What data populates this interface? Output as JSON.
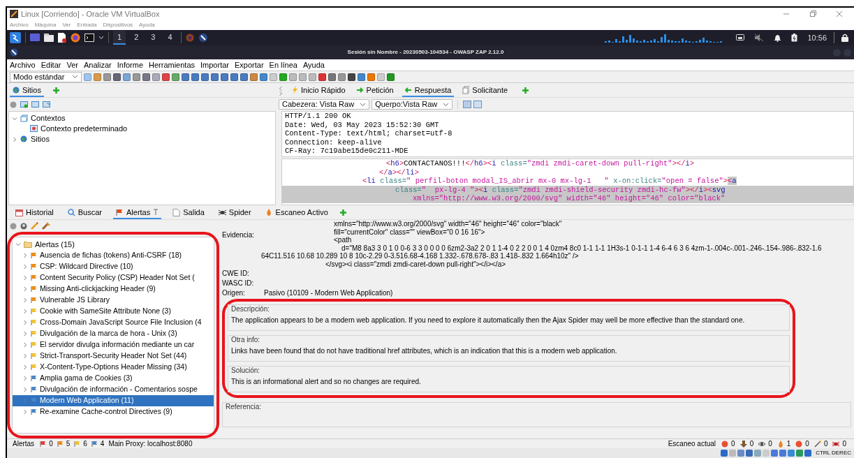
{
  "vbox_window": {
    "title": "Linux [Corriendo] - Oracle VM VirtualBox",
    "menu": [
      "Archivo",
      "Máquina",
      "Ver",
      "Entrada",
      "Dispositivos",
      "Ayuda"
    ]
  },
  "taskbar": {
    "workspaces": [
      {
        "label": "1",
        "selected": true
      },
      {
        "label": "2",
        "selected": false
      },
      {
        "label": "3",
        "selected": false
      },
      {
        "label": "4",
        "selected": false
      }
    ],
    "clock": "10:56"
  },
  "zap": {
    "title": "Sesión sin Nombre - 20230503-104534 - OWASP ZAP 2.12.0",
    "menu": [
      "Archivo",
      "Editar",
      "Ver",
      "Analizar",
      "Informe",
      "Herramientas",
      "Importar",
      "Exportar",
      "En línea",
      "Ayuda"
    ],
    "mode": "Modo estándar"
  },
  "left_tabs": [
    {
      "label": "Sitios",
      "selected": true
    }
  ],
  "right_tabs": [
    {
      "label": "Inicio Rápido",
      "selected": false
    },
    {
      "label": "Petición",
      "selected": false
    },
    {
      "label": "Respuesta",
      "selected": true
    },
    {
      "label": "Solicitante",
      "selected": false
    }
  ],
  "header_view": "Cabezera: Vista Raw",
  "body_view": "Querpo:Vista Raw",
  "sites_tree": [
    {
      "label": "Contextos",
      "expanded": true,
      "children": [
        {
          "label": "Contexto predeterminado"
        }
      ]
    },
    {
      "label": "Sitios",
      "expanded": false
    }
  ],
  "response_header": [
    "HTTP/1.1 200 OK",
    "Date: Wed, 03 May 2023 15:52:30 GMT",
    "Content-Type: text/html; charset=utf-8",
    "Connection: keep-alive",
    "CF-Ray: 7c19abe15de0c211-MDE"
  ],
  "response_body": [
    {
      "highlighted": false,
      "segments": [
        {
          "kind": "punct",
          "text": "<"
        },
        {
          "kind": "tag",
          "text": "h6"
        },
        {
          "kind": "punct",
          "text": ">"
        },
        {
          "kind": "text",
          "text": "CONTACTANOS!!!"
        },
        {
          "kind": "punct",
          "text": "</"
        },
        {
          "kind": "tag",
          "text": "h6"
        },
        {
          "kind": "punct",
          "text": "><"
        },
        {
          "kind": "tag",
          "text": "i"
        },
        {
          "kind": "attr",
          "text": " class="
        },
        {
          "kind": "value",
          "text": "\"zmdi zmdi-caret-down pull-right\""
        },
        {
          "kind": "punct",
          "text": "></"
        },
        {
          "kind": "tag",
          "text": "i"
        },
        {
          "kind": "punct",
          "text": ">"
        }
      ]
    },
    {
      "highlighted": false,
      "segments": [
        {
          "kind": "punct",
          "text": "</"
        },
        {
          "kind": "tag",
          "text": "a"
        },
        {
          "kind": "punct",
          "text": "></"
        },
        {
          "kind": "tag",
          "text": "li"
        },
        {
          "kind": "punct",
          "text": ">"
        }
      ]
    },
    {
      "highlighted": false,
      "segments": [
        {
          "kind": "punct",
          "text": "<"
        },
        {
          "kind": "tag",
          "text": "li"
        },
        {
          "kind": "attr",
          "text": " class="
        },
        {
          "kind": "value",
          "text": "\" perfil-boton modal_IS_abrir mx-0 mx-lg-1   \""
        },
        {
          "kind": "attr",
          "text": " x-on:click="
        },
        {
          "kind": "value",
          "text": "\"open = false\""
        },
        {
          "kind": "punct",
          "text": ">"
        },
        {
          "kind": "punct",
          "text": "<",
          "highlighted": true
        },
        {
          "kind": "tag",
          "text": "a",
          "highlighted": true
        }
      ]
    },
    {
      "highlighted": true,
      "segments": [
        {
          "kind": "attr",
          "text": "class="
        },
        {
          "kind": "value",
          "text": "\"  px-lg-4 \""
        },
        {
          "kind": "punct",
          "text": "><"
        },
        {
          "kind": "tag",
          "text": "i"
        },
        {
          "kind": "attr",
          "text": " class="
        },
        {
          "kind": "value",
          "text": "\"zmdi zmdi-shield-security zmdi-hc-fw\""
        },
        {
          "kind": "punct",
          "text": "></"
        },
        {
          "kind": "tag",
          "text": "i"
        },
        {
          "kind": "punct",
          "text": "><"
        },
        {
          "kind": "tag",
          "text": "svg"
        }
      ]
    },
    {
      "highlighted": true,
      "segments": [
        {
          "kind": "value",
          "text": "xmlns=\"http://www.w3.org/2000/svg\" width=\"46\" height=\"46\" color=\"black\""
        }
      ]
    }
  ],
  "bottom_tabs": [
    {
      "label": "Historial",
      "selected": false
    },
    {
      "label": "Buscar",
      "selected": false
    },
    {
      "label": "Alertas",
      "selected": true
    },
    {
      "label": "Salida",
      "selected": false
    },
    {
      "label": "Spider",
      "selected": false
    },
    {
      "label": "Escaneo Activo",
      "selected": false
    }
  ],
  "alerts": {
    "label": "Alertas (15)",
    "expanded": true,
    "children": [
      {
        "label": "Ausencia de fichas (tokens) Anti-CSRF (18)",
        "color": "#ee8a12",
        "selected": false
      },
      {
        "label": "CSP: Wildcard Directive (10)",
        "color": "#ee8a12",
        "selected": false
      },
      {
        "label": "Content Security Policy (CSP) Header Not Set (",
        "color": "#ee8a12",
        "selected": false
      },
      {
        "label": "Missing Anti-clickjacking Header (9)",
        "color": "#ee8a12",
        "selected": false
      },
      {
        "label": "Vulnerable JS Library",
        "color": "#ee8a12",
        "selected": false
      },
      {
        "label": "Cookie with SameSite Attribute None (3)",
        "color": "#f2c230",
        "selected": false
      },
      {
        "label": "Cross-Domain JavaScript Source File Inclusion (4",
        "color": "#f2c230",
        "selected": false
      },
      {
        "label": "Divulgación de la marca de hora - Unix (3)",
        "color": "#f2c230",
        "selected": false
      },
      {
        "label": "El servidor divulga información mediante un car",
        "color": "#f2c230",
        "selected": false
      },
      {
        "label": "Strict-Transport-Security Header Not Set (44)",
        "color": "#f2c230",
        "selected": false
      },
      {
        "label": "X-Content-Type-Options Header Missing (34)",
        "color": "#f2c230",
        "selected": false
      },
      {
        "label": "Amplia gama de Cookies (3)",
        "color": "#4a86c5",
        "selected": false
      },
      {
        "label": "Divulgación de información - Comentarios sospe",
        "color": "#4a86c5",
        "selected": false
      },
      {
        "label": "Modern Web Application (11)",
        "color": "#4a86c5",
        "selected": true
      },
      {
        "label": "Re-examine Cache-control Directives (9)",
        "color": "#4a86c5",
        "selected": false
      }
    ]
  },
  "details": {
    "evidence_label": "Evidencia:",
    "evidence": [
      "xmlns=\"http://www.w3.org/2000/svg\" width=\"46\" height=\"46\" color=\"black\"",
      "fill=\"currentColor\" class=\"\" viewBox=\"0 0 16 16\">",
      "<path",
      "d=\"M8 8a3 3 0 1 0 0-6 3 3 0 0 0 0 6zm2-3a2 2 0 1 1-4 0 2 2 0 0 1 4 0zm4 8c0 1-1 1-1 1H3s-1 0-1-1 1-4 6-4 6 3 6 4zm-1-.004c-.001-.246-.154-.986-.832-1.6",
      "64C11.516 10.68 10.289 10 8 10c-2.29 0-3.516.68-4.168 1.332-.678.678-.83 1.418-.832 1.664h10z\" />",
      "</svg><i class=\"zmdi zmdi-caret-down pull-right\"></i></a>"
    ],
    "fields": [
      {
        "label": "CWE ID:"
      },
      {
        "label": "WASC ID:"
      },
      {
        "label": "Origen:",
        "value": "Pasivo (10109 - Modern Web Application)"
      }
    ],
    "sections": [
      {
        "label": "Descripción:",
        "text": "The application appears to be a modern web application. If you need to explore it automatically then the Ajax Spider may well be more effective than the standard one."
      },
      {
        "label": "Otra info:",
        "text": "Links have been found that do not have traditional href attributes, which is an indication that this is a modern web application."
      },
      {
        "label": "Solución:",
        "text": "This is an informational alert and so no changes are required."
      },
      {
        "label": "Referencia:"
      }
    ]
  },
  "status_bar": {
    "alerts_label": "Alertas",
    "alert_counts": [
      {
        "color": "#e53935",
        "count": "0"
      },
      {
        "color": "#ee8a12",
        "count": "5"
      },
      {
        "color": "#f2c230",
        "count": "6"
      },
      {
        "color": "#4a86c5",
        "count": "4"
      }
    ],
    "proxy": "Main Proxy: localhost:8080",
    "scan_label": "Escaneo actual",
    "scan_counts": [
      {
        "kind": "dot",
        "count": "0"
      },
      {
        "kind": "download",
        "count": "0"
      },
      {
        "kind": "eye",
        "count": "0"
      },
      {
        "kind": "flame",
        "count": "1"
      },
      {
        "kind": "dot",
        "count": "0"
      },
      {
        "kind": "wand",
        "count": "0"
      },
      {
        "kind": "spider",
        "count": "0"
      }
    ]
  },
  "vbox_status": {
    "host_key": "CTRL DEREC"
  }
}
